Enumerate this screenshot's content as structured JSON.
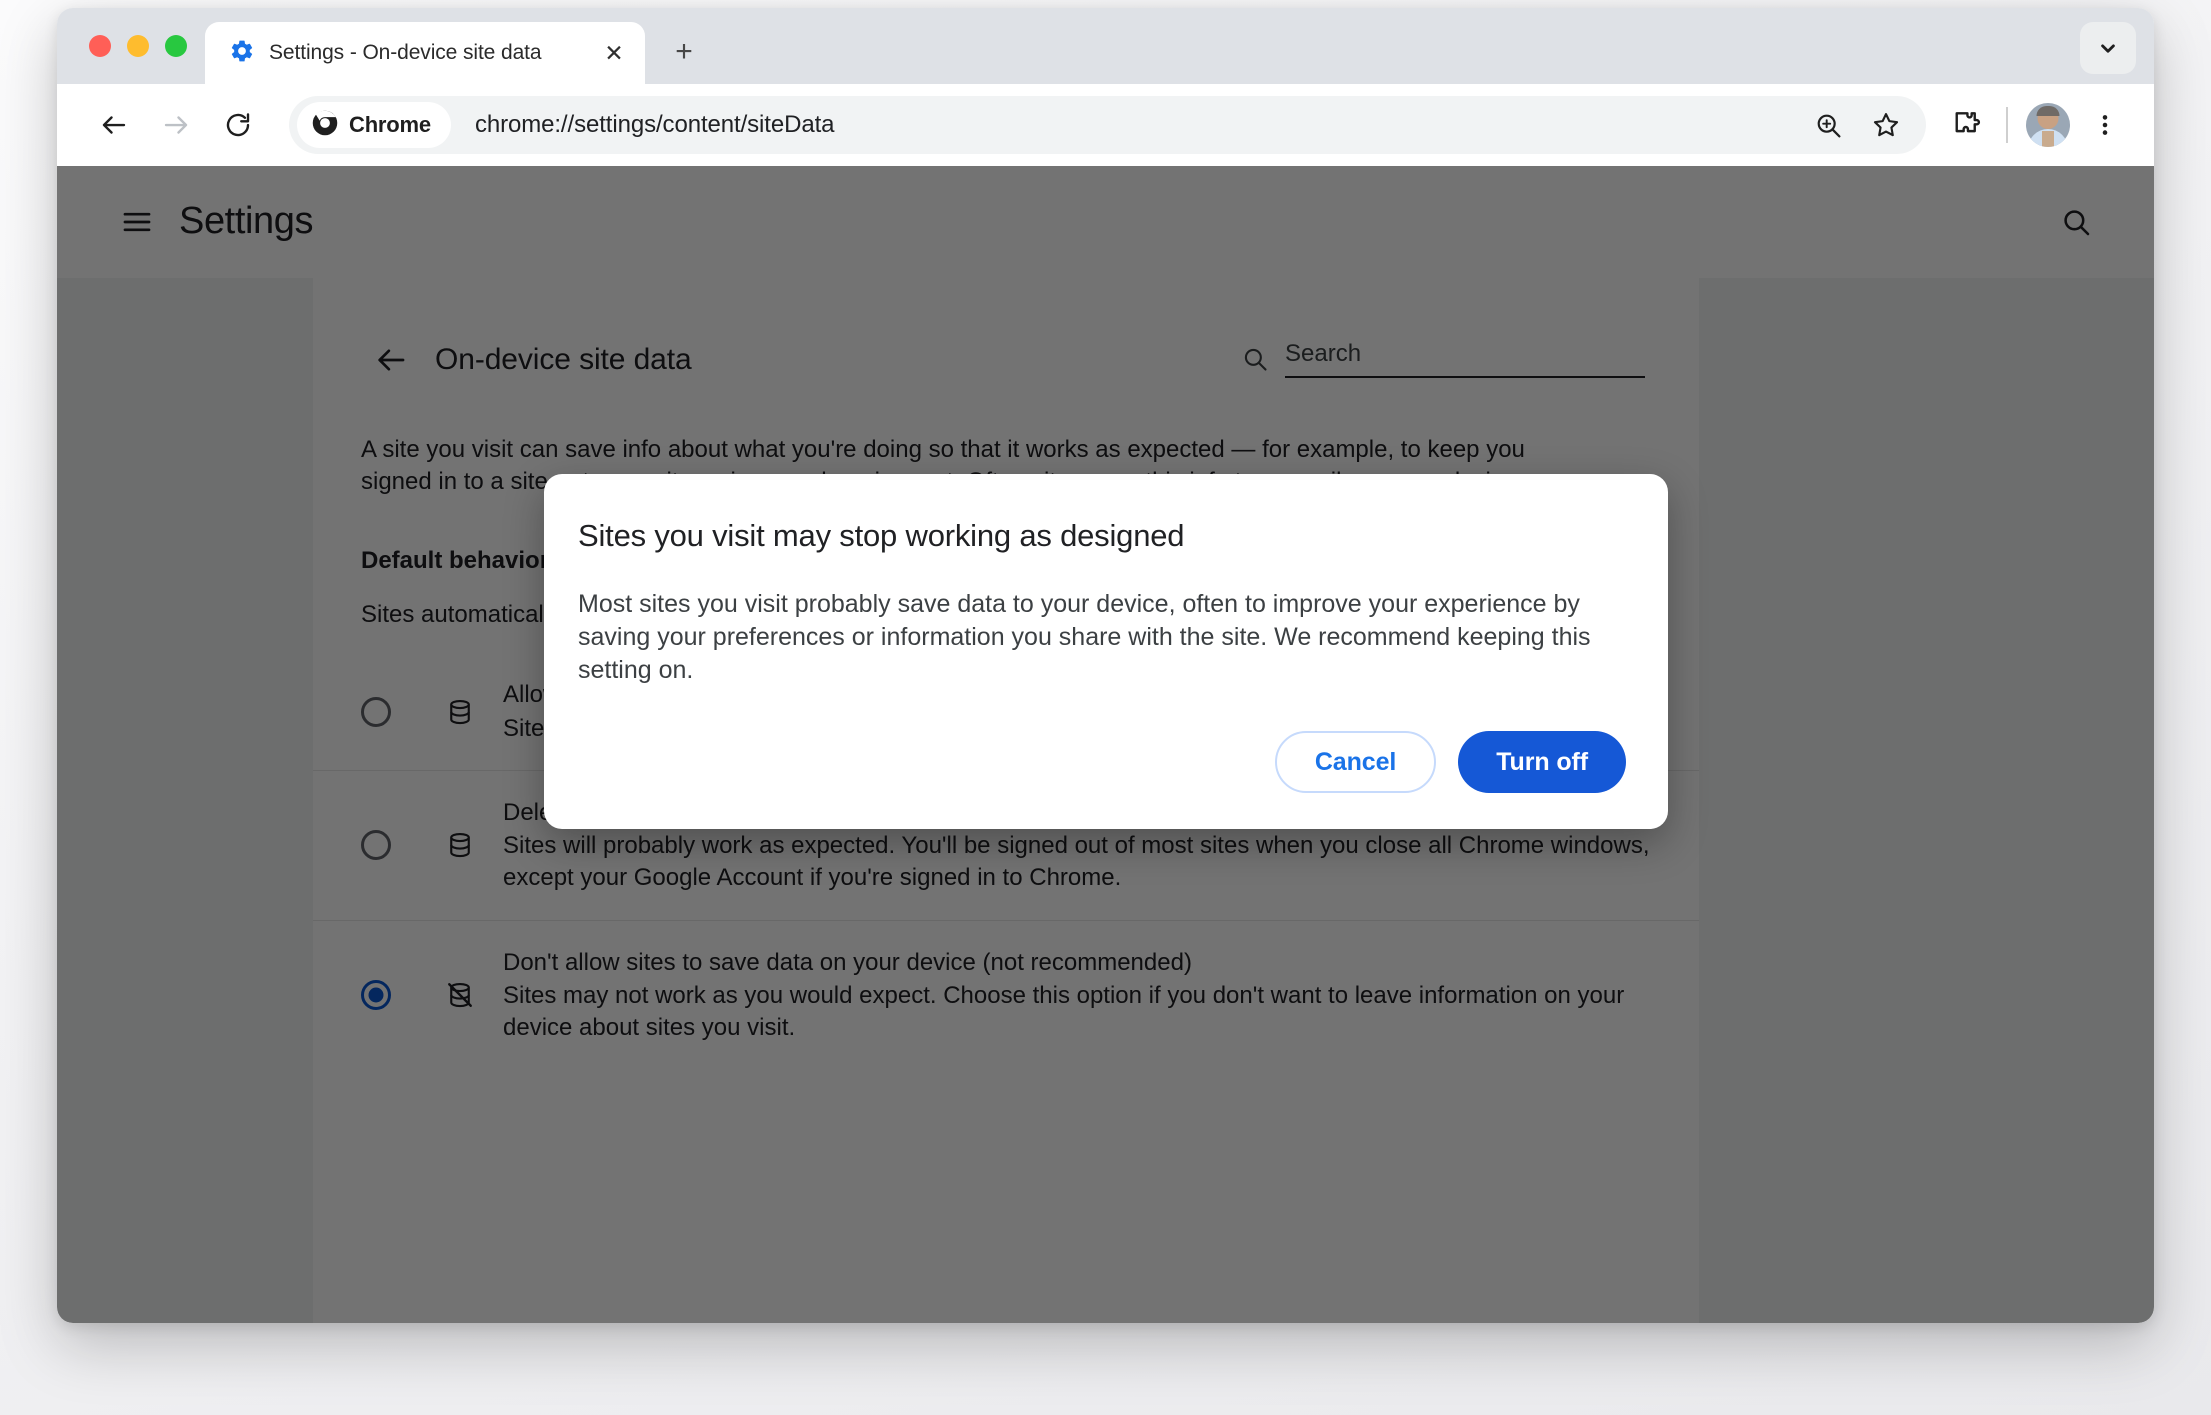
{
  "window": {
    "traffic_lights": [
      "close",
      "minimize",
      "maximize"
    ]
  },
  "tabstrip": {
    "tab_title": "Settings - On-device site data",
    "tab_favicon": "settings-gear-icon",
    "close_label": "✕",
    "new_tab_label": "+",
    "tab_list_icon": "chevron-down-icon"
  },
  "toolbar": {
    "back_icon": "back-arrow-icon",
    "forward_icon": "forward-arrow-icon",
    "reload_icon": "reload-icon",
    "chrome_chip_label": "Chrome",
    "chrome_chip_icon": "chrome-logo-icon",
    "url": "chrome://settings/content/siteData",
    "zoom_icon": "zoom-in-icon",
    "bookmark_icon": "star-outline-icon",
    "extensions_icon": "puzzle-piece-icon",
    "avatar_icon": "profile-avatar",
    "menu_icon": "three-dot-menu-icon"
  },
  "settings": {
    "menu_icon": "hamburger-menu-icon",
    "title": "Settings",
    "search_icon": "search-icon"
  },
  "subpage": {
    "back_icon": "back-arrow-icon",
    "title": "On-device site data",
    "search_icon": "search-icon",
    "search_placeholder": "Search",
    "search_value": "",
    "intro": "A site you visit can save info about what you're doing so that it works as expected — for example, to keep you signed in to a site or to save items in your shopping cart. Often sites save this info temporarily on your device.",
    "default_behavior_heading": "Default behavior",
    "default_behavior_subtitle": "Sites automatically follow this setting when you visit them"
  },
  "radio_options": [
    {
      "id": "allow-sites-to-save-data",
      "label": "Allow sites to save data on your device",
      "sublabel": "Sites will work as expected.",
      "icon": "database-icon",
      "checked": false
    },
    {
      "id": "delete-data-on-close",
      "label": "Delete data sites have saved to your device when you close all windows",
      "sublabel": "Sites will probably work as expected. You'll be signed out of most sites when you close all Chrome windows, except your Google Account if you're signed in to Chrome.",
      "icon": "database-icon",
      "checked": false
    },
    {
      "id": "dont-allow-sites-to-save-data",
      "label": "Don't allow sites to save data on your device (not recommended)",
      "sublabel": "Sites may not work as you would expect. Choose this option if you don't want to leave information on your device about sites you visit.",
      "icon": "database-off-icon",
      "checked": true
    }
  ],
  "dialog": {
    "title": "Sites you visit may stop working as designed",
    "body": "Most sites you visit probably save data to your device, often to improve your experience by saving your preferences or information you share with the site. We recommend keeping this setting on.",
    "cancel_label": "Cancel",
    "confirm_label": "Turn off"
  },
  "colors": {
    "accent_blue": "#1558d6",
    "link_blue": "#1a73e8",
    "selected_radio": "#0b57d0",
    "tabstrip_bg": "#dee1e6",
    "scrim": "rgba(0,0,0,0.55)"
  }
}
